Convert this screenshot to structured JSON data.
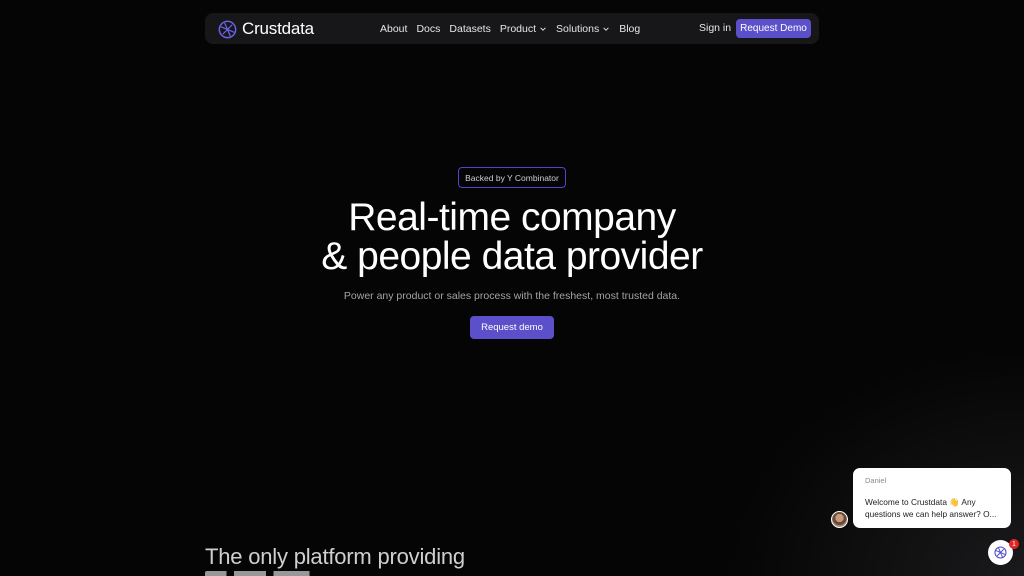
{
  "nav": {
    "logo_text": "Crustdata",
    "links": [
      {
        "label": "About"
      },
      {
        "label": "Docs"
      },
      {
        "label": "Datasets"
      },
      {
        "label": "Product",
        "dropdown": true
      },
      {
        "label": "Solutions",
        "dropdown": true
      },
      {
        "label": "Blog"
      }
    ],
    "signin_label": "Sign in",
    "demo_label": "Request Demo"
  },
  "hero": {
    "badge": "Backed by Y Combinator",
    "title_line1": "Real-time company",
    "title_line2": "& people data provider",
    "subtitle": "Power any product or sales process with the freshest, most trusted data.",
    "cta_label": "Request demo"
  },
  "section": {
    "title": "The only platform providing"
  },
  "chat": {
    "agent_name": "Daniel",
    "message": "Welcome to Crustdata 👋 Any questions we can help answer? O...",
    "unread_count": "1"
  },
  "colors": {
    "background": "#030303",
    "accent": "#5b50c9",
    "nav_bg": "#17171a"
  }
}
